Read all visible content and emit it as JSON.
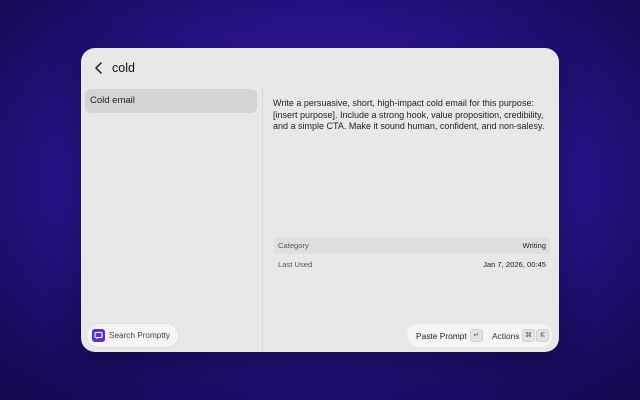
{
  "search": {
    "query": "cold"
  },
  "list": {
    "items": [
      {
        "label": "Cold email",
        "selected": true
      }
    ]
  },
  "detail": {
    "prompt": "Write a persuasive, short, high-impact cold email for this purpose: [insert purpose]. Include a strong hook, value proposition, credibility, and a simple CTA. Make it sound human, confident, and non-salesy.",
    "meta": [
      {
        "key": "Category",
        "value": "Writing"
      },
      {
        "key": "Last Used",
        "value": "Jan 7, 2026, 00:45"
      }
    ]
  },
  "footer": {
    "app_name": "Search Promptty",
    "primary_action": "Paste Prompt",
    "primary_key": "↵",
    "secondary_action": "Actions",
    "secondary_keys": [
      "⌘",
      "K"
    ]
  },
  "colors": {
    "background": "#2e1596",
    "window": "#e8e8ea",
    "selected_item": "#d4d4d7",
    "brand": "#5b2fd6"
  },
  "icons": {
    "back": "chevron-left-icon",
    "logo": "promptty-logo-icon",
    "enter": "return-key-icon"
  }
}
